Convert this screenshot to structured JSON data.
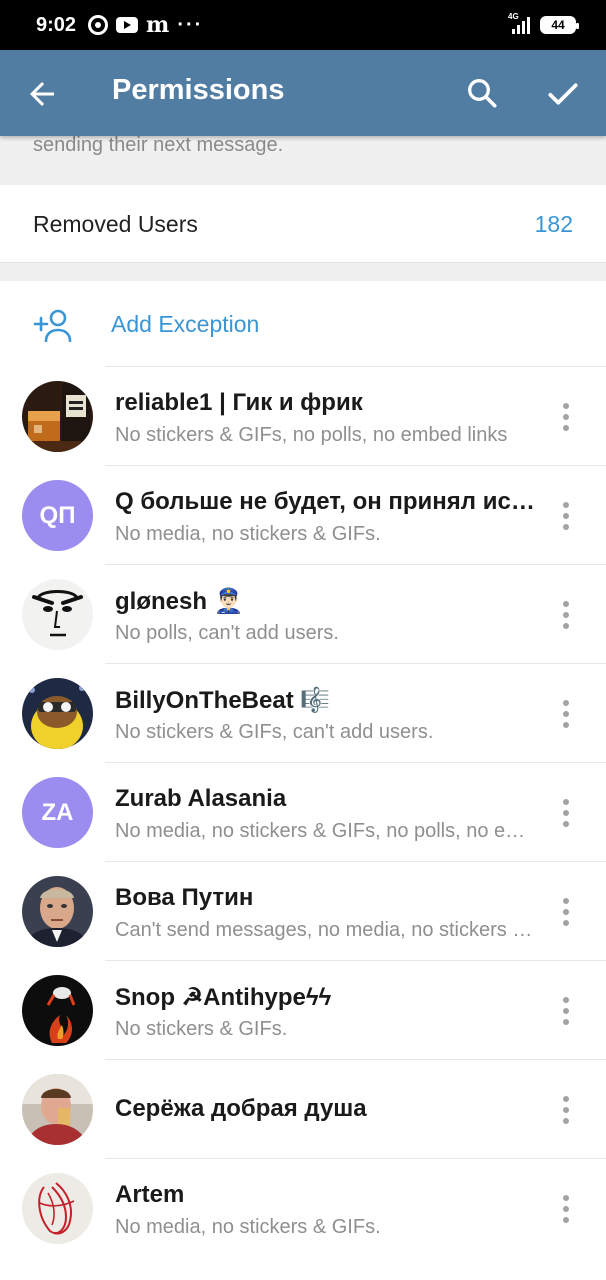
{
  "status_bar": {
    "time": "9:02",
    "network": "4G",
    "battery": "44"
  },
  "app_bar": {
    "title": "Permissions"
  },
  "info_text": "sending their next message.",
  "removed_users": {
    "label": "Removed Users",
    "count": "182"
  },
  "add_exception": {
    "label": "Add Exception"
  },
  "exceptions": [
    {
      "name": "reliable1 | Гик и фрик",
      "restrictions": "No stickers & GIFs, no polls, no embed links"
    },
    {
      "name": "Q больше не будет, он принял ислам",
      "restrictions": "No media, no stickers & GIFs.",
      "initials": "QП",
      "avatar_color": "#9b8cf0"
    },
    {
      "name": "glønesh 👮🏻‍♂️",
      "restrictions": "No polls, can't add users."
    },
    {
      "name": "BillyOnTheBeat 🎼",
      "restrictions": "No stickers & GIFs, can't add users."
    },
    {
      "name": "Zurab Alasania",
      "restrictions": "No media, no stickers & GIFs, no polls, no embed links",
      "initials": "ZA",
      "avatar_color": "#9b8cf0"
    },
    {
      "name": "Вова Путин",
      "restrictions": "Can't send messages, no media, no stickers & GIFs"
    },
    {
      "name": "Snop ☭Antihypeϟϟ",
      "restrictions": "No stickers & GIFs."
    },
    {
      "name": "Серёжа добрая душа",
      "restrictions": ""
    },
    {
      "name": "Artem",
      "restrictions": "No media, no stickers & GIFs."
    }
  ],
  "colors": {
    "app_bar": "#527da3",
    "accent": "#3a95d5",
    "avatar_letter_bg": "#9b8cf0"
  }
}
